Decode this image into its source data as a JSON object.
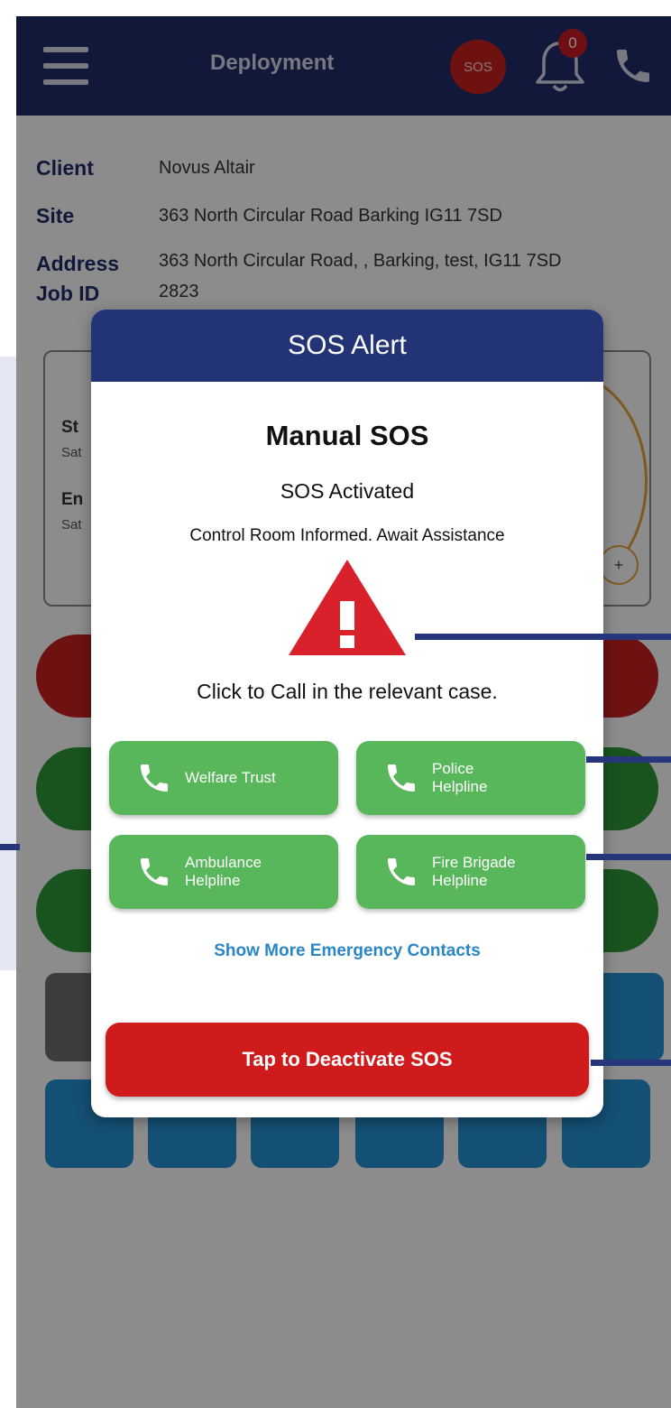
{
  "appbar": {
    "title": "Deployment",
    "sos_label": "SOS",
    "notification_count": "0",
    "icons": [
      "menu-icon",
      "bell-icon",
      "phone-icon"
    ]
  },
  "info": {
    "client_label": "Client",
    "client_value": "Novus Altair",
    "site_label": "Site",
    "site_value": "363 North Circular Road Barking IG11 7SD",
    "address_label": "Address",
    "address_value": "363 North Circular Road, , Barking, test, IG11 7SD",
    "jobid_label": "Job ID",
    "jobid_value": "2823"
  },
  "background": {
    "start_label": "St",
    "start_value": "Sat",
    "end_label": "En",
    "end_value": "Sat",
    "plus": "+"
  },
  "modal": {
    "header": "SOS Alert",
    "title": "Manual SOS",
    "status": "SOS Activated",
    "message": "Control Room Informed. Await Assistance",
    "call_hint": "Click to Call in the relevant case.",
    "buttons": [
      {
        "label": "Welfare Trust"
      },
      {
        "label": "Police\nHelpline"
      },
      {
        "label": "Ambulance\nHelpline"
      },
      {
        "label": "Fire Brigade\nHelpline"
      }
    ],
    "more_link": "Show More Emergency Contacts",
    "deactivate": "Tap to Deactivate SOS"
  },
  "colors": {
    "appbar": "#1f2c6b",
    "modal_header": "#233476",
    "call_green": "#58b75a",
    "sos_red": "#cf1b1c",
    "link_blue": "#2b86c7",
    "warning_red": "#d9212b"
  }
}
